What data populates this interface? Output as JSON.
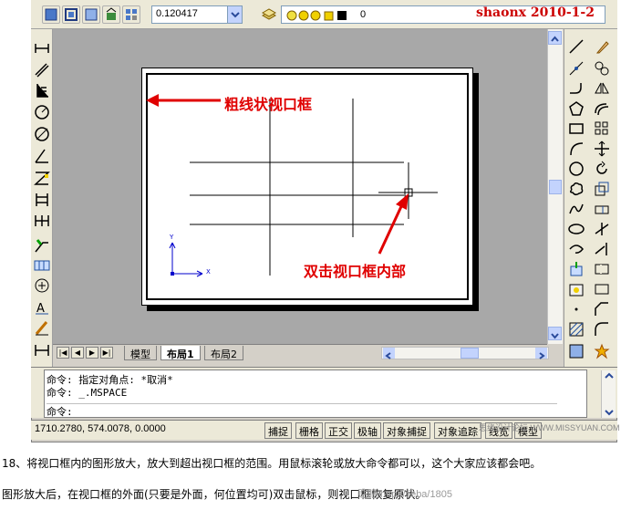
{
  "toolbar": {
    "scale_value": "0.120417",
    "layer_name": "0",
    "icons": [
      "paper-space-icon",
      "model-space-icon",
      "viewport-icon",
      "clip-icon",
      "layer-states-icon"
    ]
  },
  "watermark": "shaonx  2010-1-2",
  "annotations": {
    "viewport_border": "粗线状视口框",
    "double_click": "双击视口框内部"
  },
  "ucs": {
    "x_label": "X",
    "y_label": "Y"
  },
  "tabs": {
    "items": [
      {
        "label": "模型",
        "active": false
      },
      {
        "label": "布局1",
        "active": true
      },
      {
        "label": "布局2",
        "active": false
      }
    ],
    "nav": [
      "|◀",
      "◀",
      "▶",
      "▶|"
    ]
  },
  "command": {
    "lines": [
      "命令: 指定对角点: *取消*",
      "命令: _.MSPACE",
      "命令:"
    ]
  },
  "status": {
    "coordinates": "1710.2780, 574.0078, 0.0000",
    "buttons": [
      "捕捉",
      "栅格",
      "正交",
      "极轴",
      "对象捕捉",
      "对象追踪",
      "线宽",
      "模型"
    ]
  },
  "site_watermark": "思缘设计论坛 WWW.MISSYUAN.COM",
  "caption": {
    "line1": "18、将视口框内的图形放大，放大到超出视口框的范围。用鼠标滚轮或放大命令都可以，这个大家应该都会吧。",
    "line2": "图形放大后，在视口框的外面(只要是外面，何位置均可)双击鼠标，则视口框恢复原状。",
    "tieba": "贴吧 http://tieba/1805"
  },
  "colors": {
    "annotation_red": "#e00000",
    "ucs_blue": "#0000cc",
    "canvas_gray": "#a8a8a8"
  }
}
